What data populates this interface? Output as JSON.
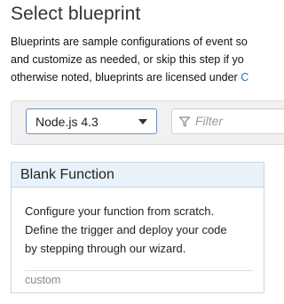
{
  "page_title": "Select blueprint",
  "description": {
    "line1": "Blueprints are sample configurations of event so",
    "line2": "and customize as needed, or skip this step if yo",
    "line3": "otherwise noted, blueprints are licensed under ",
    "link_fragment": "C"
  },
  "filters": {
    "runtime_selected": "Node.js 4.3",
    "filter_placeholder": "Filter"
  },
  "blueprint_card": {
    "title": "Blank Function",
    "description_lines": [
      "Configure your function from scratch.",
      "Define the trigger and deploy your code",
      "by stepping through our wizard."
    ],
    "tag": "custom"
  },
  "icons": {
    "runtime_dropdown": "caret-down-icon",
    "filter": "funnel-icon"
  }
}
